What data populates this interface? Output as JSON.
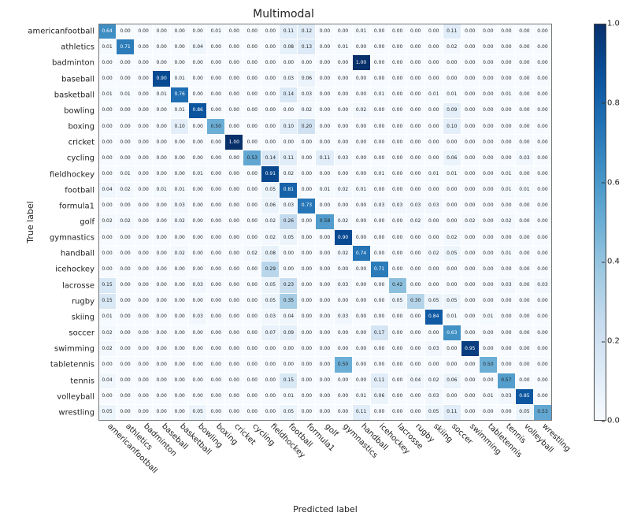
{
  "chart_data": {
    "type": "heatmap",
    "title": "Multimodal",
    "xlabel": "Predicted label",
    "ylabel": "True label",
    "categories": [
      "americanfootball",
      "athletics",
      "badminton",
      "baseball",
      "basketball",
      "bowling",
      "boxing",
      "cricket",
      "cycling",
      "fieldhockey",
      "football",
      "formula1",
      "golf",
      "gymnastics",
      "handball",
      "icehockey",
      "lacrosse",
      "rugby",
      "skiing",
      "soccer",
      "swimming",
      "tabletennis",
      "tennis",
      "volleyball",
      "wrestling"
    ],
    "colorbar_range": [
      0.0,
      1.0
    ],
    "colorbar_ticks": [
      0.0,
      0.2,
      0.4,
      0.6,
      0.8,
      1.0
    ],
    "matrix": [
      [
        0.64,
        0.0,
        0.0,
        0.0,
        0.0,
        0.0,
        0.01,
        0.0,
        0.0,
        0.0,
        0.11,
        0.12,
        0.0,
        0.0,
        0.01,
        0.0,
        0.0,
        0.0,
        0.0,
        0.11,
        0.0,
        0.0,
        0.0,
        0.0,
        0.0
      ],
      [
        0.01,
        0.71,
        0.0,
        0.0,
        0.0,
        0.04,
        0.0,
        0.0,
        0.0,
        0.0,
        0.08,
        0.13,
        0.0,
        0.01,
        0.0,
        0.0,
        0.0,
        0.0,
        0.0,
        0.02,
        0.0,
        0.0,
        0.0,
        0.0,
        0.0
      ],
      [
        0.0,
        0.0,
        0.0,
        0.0,
        0.0,
        0.0,
        0.0,
        0.0,
        0.0,
        0.0,
        0.0,
        0.0,
        0.0,
        0.0,
        1.0,
        0.0,
        0.0,
        0.0,
        0.0,
        0.0,
        0.0,
        0.0,
        0.0,
        0.0,
        0.0
      ],
      [
        0.0,
        0.0,
        0.0,
        0.9,
        0.01,
        0.0,
        0.0,
        0.0,
        0.0,
        0.0,
        0.03,
        0.06,
        0.0,
        0.0,
        0.0,
        0.0,
        0.0,
        0.0,
        0.0,
        0.0,
        0.0,
        0.0,
        0.0,
        0.0,
        0.0
      ],
      [
        0.01,
        0.01,
        0.0,
        0.01,
        0.76,
        0.0,
        0.0,
        0.0,
        0.0,
        0.0,
        0.14,
        0.03,
        0.0,
        0.0,
        0.0,
        0.01,
        0.0,
        0.0,
        0.01,
        0.01,
        0.0,
        0.0,
        0.01,
        0.0,
        0.0
      ],
      [
        0.0,
        0.0,
        0.0,
        0.0,
        0.01,
        0.86,
        0.0,
        0.0,
        0.0,
        0.0,
        0.0,
        0.02,
        0.0,
        0.0,
        0.02,
        0.0,
        0.0,
        0.0,
        0.0,
        0.09,
        0.0,
        0.0,
        0.0,
        0.0,
        0.0
      ],
      [
        0.0,
        0.0,
        0.0,
        0.0,
        0.1,
        0.0,
        0.5,
        0.0,
        0.0,
        0.0,
        0.1,
        0.2,
        0.0,
        0.0,
        0.0,
        0.0,
        0.0,
        0.0,
        0.0,
        0.1,
        0.0,
        0.0,
        0.0,
        0.0,
        0.0
      ],
      [
        0.0,
        0.0,
        0.0,
        0.0,
        0.0,
        0.0,
        0.0,
        1.0,
        0.0,
        0.0,
        0.0,
        0.0,
        0.0,
        0.0,
        0.0,
        0.0,
        0.0,
        0.0,
        0.0,
        0.0,
        0.0,
        0.0,
        0.0,
        0.0,
        0.0
      ],
      [
        0.0,
        0.0,
        0.0,
        0.0,
        0.0,
        0.0,
        0.0,
        0.0,
        0.53,
        0.14,
        0.11,
        0.0,
        0.11,
        0.03,
        0.0,
        0.0,
        0.0,
        0.0,
        0.0,
        0.06,
        0.0,
        0.0,
        0.0,
        0.03,
        0.0
      ],
      [
        0.0,
        0.01,
        0.0,
        0.0,
        0.0,
        0.01,
        0.0,
        0.0,
        0.0,
        0.91,
        0.02,
        0.0,
        0.0,
        0.0,
        0.0,
        0.01,
        0.0,
        0.0,
        0.01,
        0.01,
        0.0,
        0.0,
        0.01,
        0.0,
        0.0
      ],
      [
        0.04,
        0.02,
        0.0,
        0.01,
        0.01,
        0.0,
        0.0,
        0.0,
        0.0,
        0.05,
        0.81,
        0.0,
        0.01,
        0.02,
        0.01,
        0.0,
        0.0,
        0.0,
        0.0,
        0.0,
        0.0,
        0.0,
        0.01,
        0.01,
        0.0
      ],
      [
        0.0,
        0.0,
        0.0,
        0.0,
        0.03,
        0.0,
        0.0,
        0.0,
        0.0,
        0.06,
        0.03,
        0.73,
        0.0,
        0.0,
        0.0,
        0.03,
        0.03,
        0.03,
        0.03,
        0.0,
        0.0,
        0.0,
        0.0,
        0.0,
        0.0
      ],
      [
        0.02,
        0.02,
        0.0,
        0.0,
        0.02,
        0.0,
        0.0,
        0.0,
        0.0,
        0.02,
        0.26,
        0.0,
        0.58,
        0.02,
        0.0,
        0.0,
        0.0,
        0.02,
        0.0,
        0.0,
        0.02,
        0.0,
        0.02,
        0.0,
        0.0
      ],
      [
        0.0,
        0.0,
        0.0,
        0.0,
        0.0,
        0.0,
        0.0,
        0.0,
        0.0,
        0.02,
        0.05,
        0.0,
        0.0,
        0.9,
        0.0,
        0.0,
        0.0,
        0.0,
        0.0,
        0.02,
        0.0,
        0.0,
        0.0,
        0.0,
        0.0
      ],
      [
        0.0,
        0.0,
        0.0,
        0.0,
        0.02,
        0.0,
        0.0,
        0.0,
        0.02,
        0.08,
        0.0,
        0.0,
        0.0,
        0.02,
        0.74,
        0.0,
        0.0,
        0.0,
        0.02,
        0.05,
        0.0,
        0.0,
        0.01,
        0.0,
        0.0
      ],
      [
        0.0,
        0.0,
        0.0,
        0.0,
        0.0,
        0.0,
        0.0,
        0.0,
        0.0,
        0.29,
        0.0,
        0.0,
        0.0,
        0.0,
        0.0,
        0.71,
        0.0,
        0.0,
        0.0,
        0.0,
        0.0,
        0.0,
        0.0,
        0.0,
        0.0
      ],
      [
        0.15,
        0.0,
        0.0,
        0.0,
        0.0,
        0.03,
        0.0,
        0.0,
        0.0,
        0.05,
        0.23,
        0.0,
        0.0,
        0.03,
        0.0,
        0.0,
        0.42,
        0.0,
        0.0,
        0.0,
        0.0,
        0.0,
        0.03,
        0.0,
        0.03
      ],
      [
        0.15,
        0.0,
        0.0,
        0.0,
        0.0,
        0.0,
        0.0,
        0.0,
        0.0,
        0.05,
        0.35,
        0.0,
        0.0,
        0.0,
        0.0,
        0.0,
        0.05,
        0.3,
        0.05,
        0.05,
        0.0,
        0.0,
        0.0,
        0.0,
        0.0
      ],
      [
        0.01,
        0.0,
        0.0,
        0.0,
        0.0,
        0.03,
        0.0,
        0.0,
        0.0,
        0.03,
        0.04,
        0.0,
        0.0,
        0.03,
        0.0,
        0.0,
        0.0,
        0.0,
        0.84,
        0.01,
        0.0,
        0.01,
        0.0,
        0.0,
        0.0
      ],
      [
        0.02,
        0.0,
        0.0,
        0.0,
        0.0,
        0.0,
        0.0,
        0.0,
        0.0,
        0.07,
        0.09,
        0.0,
        0.0,
        0.0,
        0.0,
        0.17,
        0.0,
        0.0,
        0.0,
        0.63,
        0.0,
        0.0,
        0.0,
        0.0,
        0.0
      ],
      [
        0.02,
        0.0,
        0.0,
        0.0,
        0.0,
        0.0,
        0.0,
        0.0,
        0.0,
        0.0,
        0.0,
        0.0,
        0.0,
        0.0,
        0.0,
        0.0,
        0.0,
        0.0,
        0.03,
        0.0,
        0.95,
        0.0,
        0.0,
        0.0,
        0.0
      ],
      [
        0.0,
        0.0,
        0.0,
        0.0,
        0.0,
        0.0,
        0.0,
        0.0,
        0.0,
        0.0,
        0.0,
        0.0,
        0.0,
        0.5,
        0.0,
        0.0,
        0.0,
        0.0,
        0.0,
        0.0,
        0.0,
        0.5,
        0.0,
        0.0,
        0.0
      ],
      [
        0.04,
        0.0,
        0.0,
        0.0,
        0.0,
        0.0,
        0.0,
        0.0,
        0.0,
        0.0,
        0.15,
        0.0,
        0.0,
        0.0,
        0.0,
        0.11,
        0.0,
        0.04,
        0.02,
        0.06,
        0.0,
        0.0,
        0.57,
        0.0,
        0.0
      ],
      [
        0.0,
        0.0,
        0.0,
        0.0,
        0.0,
        0.0,
        0.0,
        0.0,
        0.0,
        0.0,
        0.01,
        0.0,
        0.0,
        0.0,
        0.01,
        0.06,
        0.0,
        0.0,
        0.03,
        0.0,
        0.0,
        0.01,
        0.03,
        0.85,
        0.0
      ],
      [
        0.05,
        0.0,
        0.0,
        0.0,
        0.0,
        0.05,
        0.0,
        0.0,
        0.0,
        0.0,
        0.05,
        0.0,
        0.0,
        0.0,
        0.11,
        0.0,
        0.0,
        0.0,
        0.05,
        0.11,
        0.0,
        0.0,
        0.0,
        0.05,
        0.53
      ]
    ]
  }
}
